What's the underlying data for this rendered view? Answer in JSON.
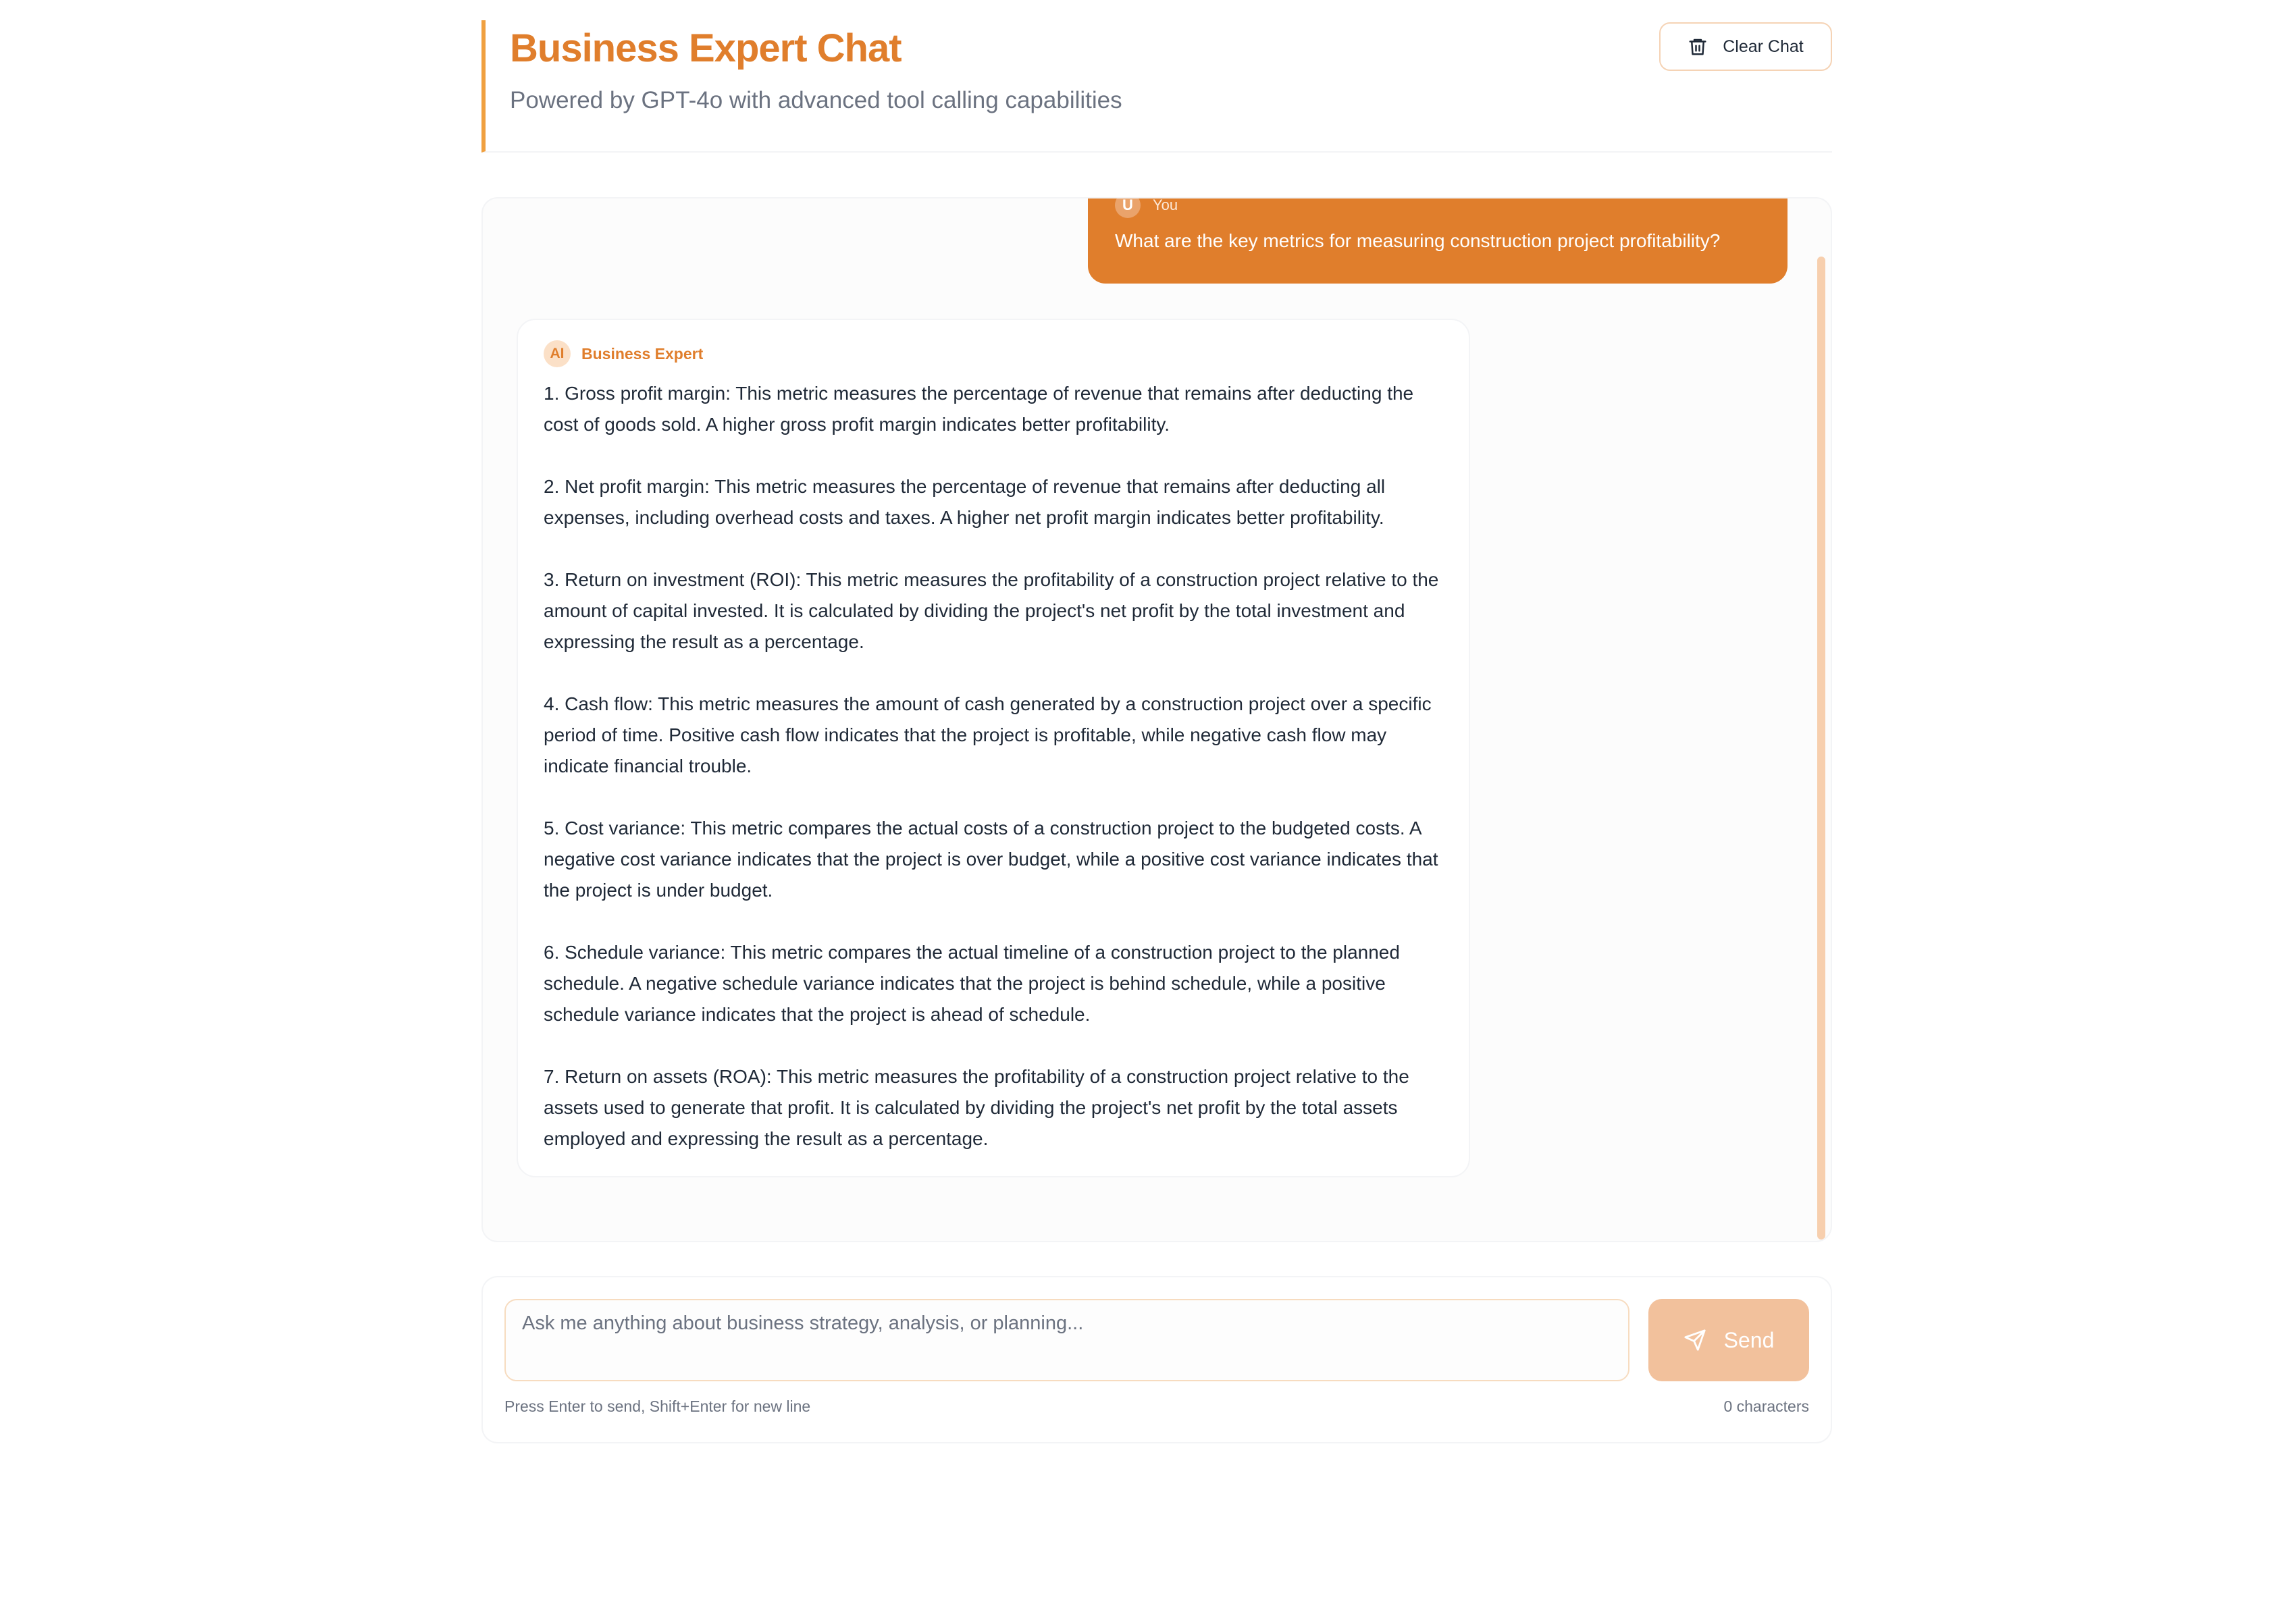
{
  "header": {
    "title": "Business Expert Chat",
    "subtitle": "Powered by GPT-4o with advanced tool calling capabilities",
    "clear_label": "Clear Chat",
    "clear_icon": "trash-icon"
  },
  "theme": {
    "accent": "#e07e2c",
    "accent_light": "#f2c19c",
    "border": "#f3f4f6"
  },
  "messages": {
    "user": {
      "avatar": "U",
      "name": "You",
      "text": "What are the key metrics for measuring construction project profitability?"
    },
    "ai": {
      "avatar": "AI",
      "name": "Business Expert",
      "paragraphs": [
        "1. Gross profit margin: This metric measures the percentage of revenue that remains after deducting the cost of goods sold. A higher gross profit margin indicates better profitability.",
        "2. Net profit margin: This metric measures the percentage of revenue that remains after deducting all expenses, including overhead costs and taxes. A higher net profit margin indicates better profitability.",
        "3. Return on investment (ROI): This metric measures the profitability of a construction project relative to the amount of capital invested. It is calculated by dividing the project's net profit by the total investment and expressing the result as a percentage.",
        "4. Cash flow: This metric measures the amount of cash generated by a construction project over a specific period of time. Positive cash flow indicates that the project is profitable, while negative cash flow may indicate financial trouble.",
        "5. Cost variance: This metric compares the actual costs of a construction project to the budgeted costs. A negative cost variance indicates that the project is over budget, while a positive cost variance indicates that the project is under budget.",
        "6. Schedule variance: This metric compares the actual timeline of a construction project to the planned schedule. A negative schedule variance indicates that the project is behind schedule, while a positive schedule variance indicates that the project is ahead of schedule.",
        "7. Return on assets (ROA): This metric measures the profitability of a construction project relative to the assets used to generate that profit. It is calculated by dividing the project's net profit by the total assets employed and expressing the result as a percentage."
      ]
    }
  },
  "composer": {
    "placeholder": "Ask me anything about business strategy, analysis, or planning...",
    "value": "",
    "send_label": "Send",
    "send_icon": "send-icon",
    "hint": "Press Enter to send, Shift+Enter for new line",
    "char_count": "0 characters"
  }
}
